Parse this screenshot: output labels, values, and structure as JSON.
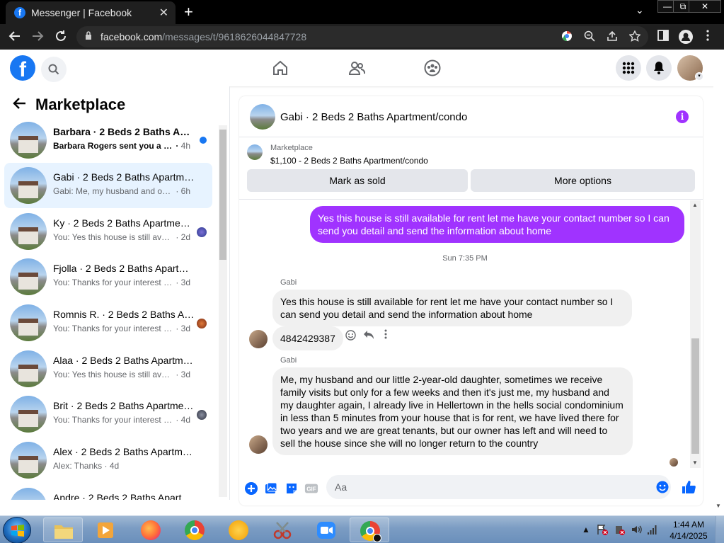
{
  "browser": {
    "tab_title": "Messenger | Facebook",
    "tab_favicon": "f",
    "url_host": "facebook.com",
    "url_path": "/messages/t/9618626044847728",
    "controls": {
      "minimize": "—",
      "restore": "⧉",
      "close": "✕",
      "new_tab": "+",
      "tab_close": "✕",
      "tab_list": "⌄"
    }
  },
  "fb": {
    "logo": "f"
  },
  "sidebar": {
    "title": "Marketplace",
    "conversations": [
      {
        "name": "Barbara · 2 Beds 2 Baths Apartment/condo",
        "preview": "Barbara Rogers sent you a message",
        "time": "4h",
        "unread": true
      },
      {
        "name": "Gabi · 2 Beds 2 Baths Apartment/condo",
        "preview": "Gabi: Me, my husband and our little 2-year-old",
        "time": "6h",
        "active": true
      },
      {
        "name": "Ky · 2 Beds 2 Baths Apartment/condo",
        "preview": "You: Yes this house is still available",
        "time": "2d"
      },
      {
        "name": "Fjolla · 2 Beds 2 Baths Apartment/condo",
        "preview": "You: Thanks for your interest in the...",
        "time": "3d"
      },
      {
        "name": "Romnis R. · 2 Beds 2 Baths Apartment/condo",
        "preview": "You: Thanks for your interest in the",
        "time": "3d"
      },
      {
        "name": "Alaa · 2 Beds 2 Baths Apartment/condo",
        "preview": "You: Yes this house is still available for rent",
        "time": "3d"
      },
      {
        "name": "Brit · 2 Beds 2 Baths Apartment/condo",
        "preview": "You: Thanks for your interest in the",
        "time": "4d"
      },
      {
        "name": "Alex · 2 Beds 2 Baths Apartment/condo",
        "preview": "Alex: Thanks",
        "time": "4d"
      },
      {
        "name": "Andre · 2 Beds 2 Baths Apartment/condo",
        "preview": "",
        "time": ""
      }
    ]
  },
  "chat": {
    "title": "Gabi · 2 Beds 2 Baths Apartment/condo",
    "listing": {
      "category": "Marketplace",
      "price_line": "$1,100 - 2 Beds 2 Baths Apartment/condo",
      "mark_sold": "Mark as sold",
      "more_options": "More options"
    },
    "messages": {
      "outgoing_1": "Yes this house is still available for rent let me have your contact number so I can send you detail and send the information about home",
      "timestamp": "Sun 7:35 PM",
      "sender": "Gabi",
      "reply_quote": "Yes this house is still available for rent let me have your contact number so I can send you detail and send the information about home",
      "reply": "4842429387",
      "incoming_2": "Me, my husband and our little 2-year-old daughter, sometimes we receive family visits but only for a few weeks and then it's just me, my husband and my daughter again, I already live in Hellertown in the hells social condominium in less than 5 minutes from your house that is for rent, we have lived there for two years and we are great tenants, but our owner has left and will need to sell the house since she will no longer return to the country"
    },
    "composer": {
      "placeholder": "Aa",
      "gif_label": "GIF"
    }
  },
  "taskbar": {
    "time": "1:44 AM",
    "date": "4/14/2025"
  },
  "colors": {
    "fb_blue": "#1877f2",
    "messenger_purple": "#a033ff",
    "active_convo": "#e7f3ff"
  }
}
